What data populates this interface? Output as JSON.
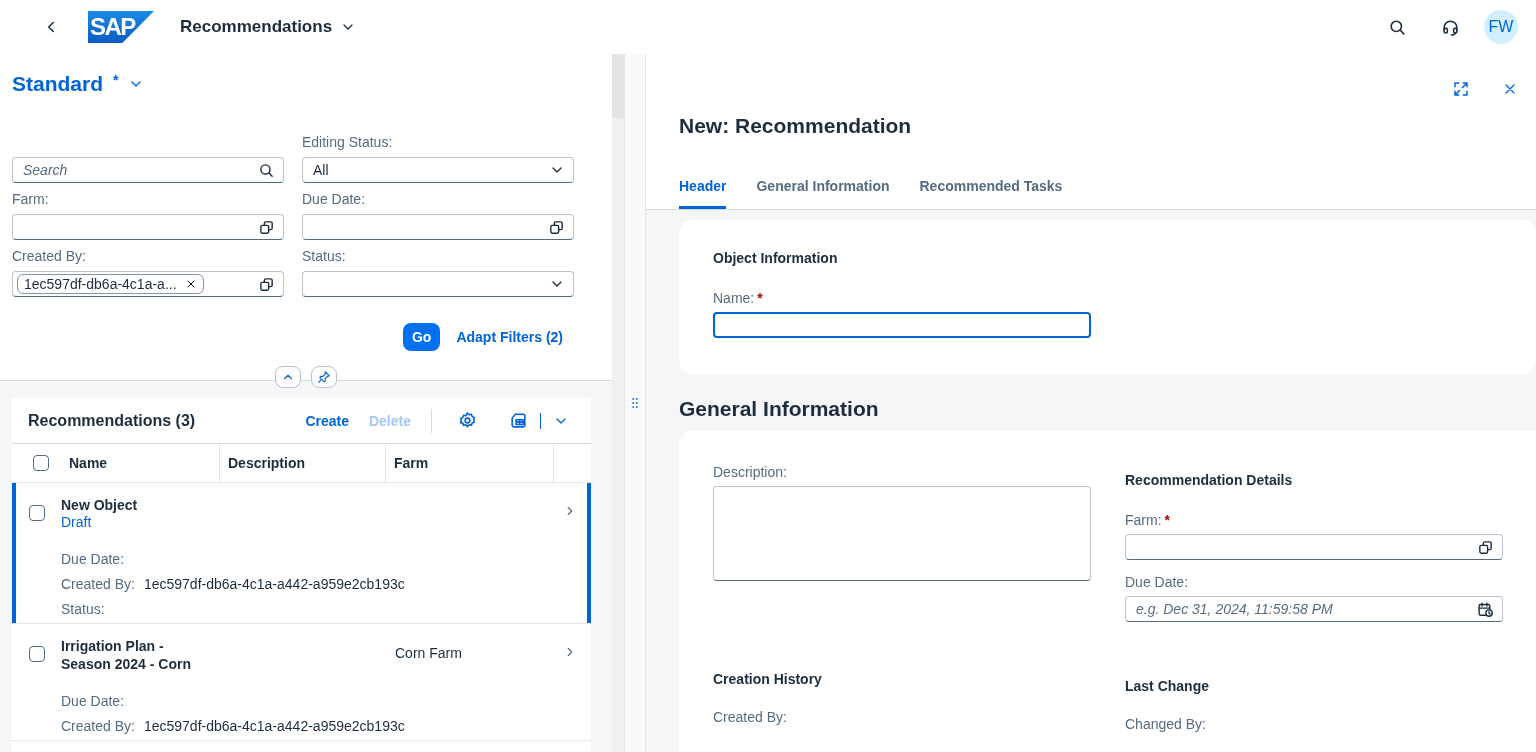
{
  "shell": {
    "logo_text": "SAP",
    "title": "Recommendations",
    "avatar": "FW"
  },
  "variant": {
    "name": "Standard",
    "modified_mark": "*"
  },
  "filters": {
    "search": {
      "placeholder": "Search"
    },
    "fields": [
      {
        "label": "Editing Status:",
        "kind": "select",
        "value": "All"
      },
      {
        "label": "Farm:",
        "kind": "valuehelp"
      },
      {
        "label": "Due Date:",
        "kind": "valuehelp"
      },
      {
        "label": "Created By:",
        "kind": "valuehelp",
        "token": "1ec597df-db6a-4c1a-a..."
      },
      {
        "label": "Status:",
        "kind": "select"
      }
    ],
    "go": "Go",
    "adapt": "Adapt Filters (2)"
  },
  "table": {
    "title": "Recommendations (3)",
    "actions": [
      {
        "label": "Create",
        "disabled": false
      },
      {
        "label": "Delete",
        "disabled": true
      }
    ],
    "select_all": {
      "checked": false
    },
    "columns": [
      "Name",
      "Description",
      "Farm"
    ],
    "rows": [
      {
        "name": "New Object",
        "status": "Draft",
        "selected": true,
        "checked": false,
        "details": [
          {
            "label": "Due Date:"
          },
          {
            "label": "Created By:",
            "value": "1ec597df-db6a-4c1a-a442-a959e2cb193c"
          },
          {
            "label": "Status:"
          }
        ]
      },
      {
        "name": "Irrigation Plan - Season 2024 - Corn",
        "farm": "Corn Farm",
        "selected": false,
        "checked": false,
        "details": [
          {
            "label": "Due Date:"
          },
          {
            "label": "Created By:",
            "value": "1ec597df-db6a-4c1a-a442-a959e2cb193c"
          }
        ]
      }
    ]
  },
  "object": {
    "title": "New: Recommendation",
    "tabs": [
      {
        "label": "Header",
        "selected": true
      },
      {
        "label": "General Information",
        "selected": false
      },
      {
        "label": "Recommended Tasks",
        "selected": false
      }
    ],
    "header_section": {
      "group_title": "Object Information",
      "field": {
        "label": "Name:",
        "required_mark": "*",
        "focused": true
      }
    },
    "general": {
      "title": "General Information",
      "description_label": "Description:",
      "details_title": "Recommendation Details",
      "farm": {
        "label": "Farm:",
        "required_mark": "*"
      },
      "due_date": {
        "label": "Due Date:",
        "placeholder": "e.g. Dec 31, 2024, 11:59:58 PM"
      },
      "creation_title": "Creation History",
      "created_by_label": "Created By:",
      "change_title": "Last Change",
      "changed_by_label": "Changed By:"
    }
  }
}
